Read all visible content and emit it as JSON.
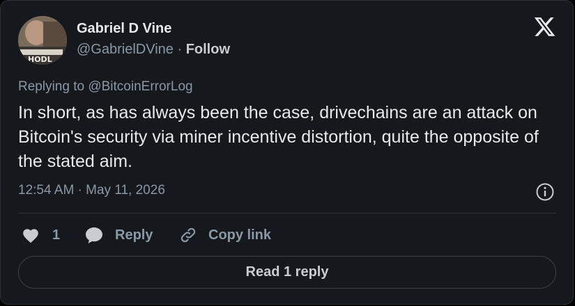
{
  "author": {
    "name": "Gabriel D Vine",
    "handle": "@GabrielDVine",
    "separator": "·",
    "follow_label": "Follow",
    "avatar_text": "HODL"
  },
  "platform": {
    "logo_icon": "x-logo-icon"
  },
  "tweet": {
    "replying_to": "Replying to @BitcoinErrorLog",
    "text": "In short, as has always been the case, drivechains are an attack on Bitcoin's security via miner incentive distortion, quite the opposite of the stated aim.",
    "timestamp": "12:54 AM · May 11, 2026"
  },
  "actions": {
    "like_icon": "heart-icon",
    "like_count": "1",
    "reply_icon": "speech-bubble-icon",
    "reply_label": "Reply",
    "copy_icon": "link-icon",
    "copy_label": "Copy link",
    "info_icon": "info-icon"
  },
  "footer": {
    "read_replies_label": "Read 1 reply"
  },
  "colors": {
    "card_bg": "#15181c",
    "text_primary": "#e7e9ea",
    "text_secondary": "#8b98a5",
    "border": "#2f3336"
  }
}
